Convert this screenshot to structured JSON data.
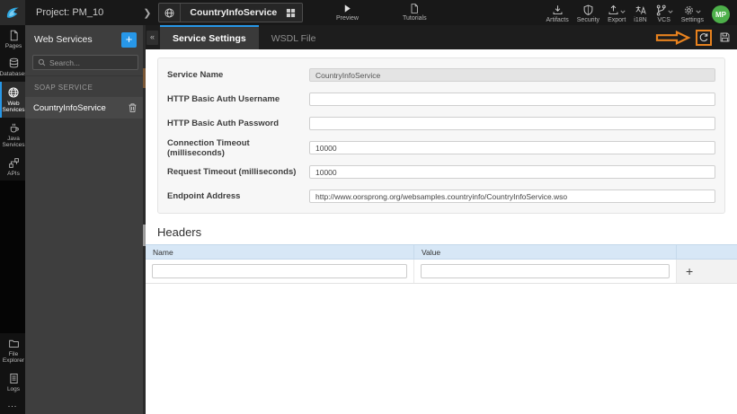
{
  "topbar": {
    "project_label": "Project: PM_10",
    "breadcrumb_chevron": "❯",
    "service_name": "CountryInfoService",
    "preview_label": "Preview",
    "tutorials_label": "Tutorials",
    "artifacts_label": "Artifacts",
    "security_label": "Security",
    "export_label": "Export",
    "i18n_label": "i18N",
    "vcs_label": "VCS",
    "settings_label": "Settings",
    "avatar_initials": "MP"
  },
  "sidebar": {
    "items": [
      {
        "label": "Pages"
      },
      {
        "label": "Databases"
      },
      {
        "label": "Web Services",
        "active": true
      },
      {
        "label": "Java Services"
      },
      {
        "label": "APIs"
      }
    ],
    "bottom_items": [
      {
        "label": "File Explorer"
      },
      {
        "label": "Logs"
      }
    ],
    "more_label": "..."
  },
  "panel": {
    "title": "Web Services",
    "add_label": "+",
    "search_placeholder": "Search...",
    "section_label": "SOAP SERVICE",
    "items": [
      {
        "label": "CountryInfoService",
        "selected": true
      }
    ]
  },
  "content": {
    "collapse_label": "«",
    "tabs": [
      {
        "label": "Service Settings",
        "active": true
      },
      {
        "label": "WSDL File"
      }
    ]
  },
  "form": {
    "fields": [
      {
        "label": "Service Name",
        "value": "CountryInfoService",
        "disabled": true
      },
      {
        "label": "HTTP Basic Auth Username",
        "value": ""
      },
      {
        "label": "HTTP Basic Auth Password",
        "value": ""
      },
      {
        "label": "Connection Timeout (milliseconds)",
        "value": "10000"
      },
      {
        "label": "Request Timeout (milliseconds)",
        "value": "10000"
      },
      {
        "label": "Endpoint Address",
        "value": "http://www.oorsprong.org/websamples.countryinfo/CountryInfoService.wso"
      }
    ]
  },
  "headers_section": {
    "title": "Headers",
    "columns": [
      "Name",
      "Value"
    ],
    "rows": [
      {
        "name": "",
        "value": ""
      }
    ],
    "add_row_label": "+"
  },
  "colors": {
    "accent_blue": "#2797e8",
    "annotation_orange": "#e8821e",
    "avatar_green": "#4db04a",
    "table_header_bg": "#d7e7f6"
  }
}
